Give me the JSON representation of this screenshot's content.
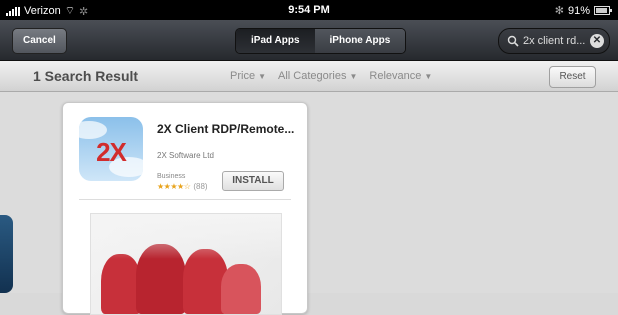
{
  "statusbar": {
    "carrier": "Verizon",
    "time": "9:54 PM",
    "battery": "91%",
    "battery_level": 0.91
  },
  "navbar": {
    "cancel_label": "Cancel",
    "segments": [
      "iPad Apps",
      "iPhone Apps"
    ],
    "active_segment": "iPad Apps",
    "search_value": "2x client rd..."
  },
  "filterbar": {
    "result_count": "1 Search Result",
    "filters": [
      "Price",
      "All Categories",
      "Relevance"
    ],
    "reset_label": "Reset"
  },
  "app": {
    "icon_text": "2X",
    "title": "2X Client RDP/Remote...",
    "developer": "2X Software Ltd",
    "category": "Business",
    "stars": "★★★★☆",
    "rating_count": "(88)",
    "install_label": "INSTALL"
  },
  "colors": {
    "navbar": "#3a3d43",
    "accent_red": "#c7303a",
    "star": "#e8a31b"
  }
}
